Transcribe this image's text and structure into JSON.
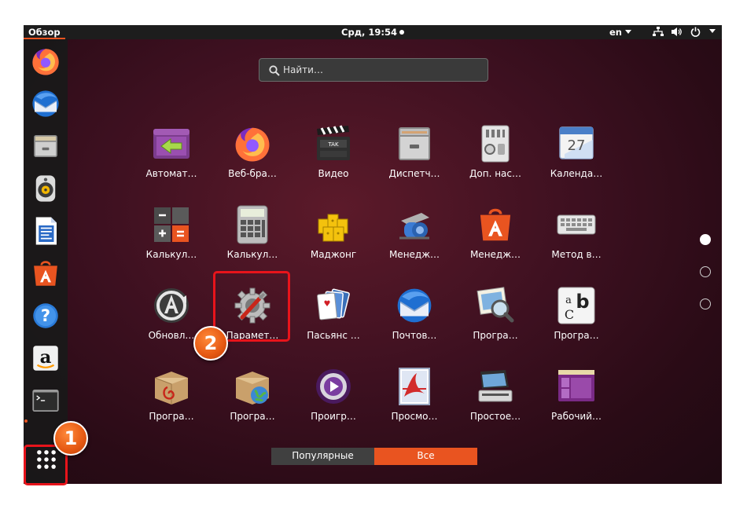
{
  "topbar": {
    "overview_label": "Обзор",
    "clock": "Срд, 19:54",
    "language": "en"
  },
  "dock": {
    "items": [
      {
        "name": "Firefox",
        "icon": "firefox-icon"
      },
      {
        "name": "Thunderbird",
        "icon": "thunderbird-icon"
      },
      {
        "name": "Files",
        "icon": "files-icon"
      },
      {
        "name": "Rhythmbox",
        "icon": "rhythmbox-icon"
      },
      {
        "name": "LibreOffice Writer",
        "icon": "writer-icon"
      },
      {
        "name": "Ubuntu Software",
        "icon": "software-icon"
      },
      {
        "name": "Help",
        "icon": "help-icon"
      },
      {
        "name": "Amazon",
        "icon": "amazon-icon"
      },
      {
        "name": "Terminal",
        "icon": "terminal-icon"
      }
    ],
    "show_apps_icon": "grid-icon"
  },
  "search": {
    "placeholder": "Найти…"
  },
  "apps": [
    {
      "label": "Автомат…",
      "icon": "automation-icon"
    },
    {
      "label": "Веб-бра…",
      "icon": "firefox-icon"
    },
    {
      "label": "Видео",
      "icon": "video-icon"
    },
    {
      "label": "Диспетч…",
      "icon": "archive-manager-icon"
    },
    {
      "label": "Доп. нас…",
      "icon": "tweaks-icon"
    },
    {
      "label": "Календа…",
      "icon": "calendar-icon"
    },
    {
      "label": "Калькул…",
      "icon": "calculator-orange-icon"
    },
    {
      "label": "Калькул…",
      "icon": "calculator-gray-icon"
    },
    {
      "label": "Маджонг",
      "icon": "mahjongg-icon"
    },
    {
      "label": "Менедж…",
      "icon": "printer-manager-icon"
    },
    {
      "label": "Менедж…",
      "icon": "software-icon"
    },
    {
      "label": "Метод в…",
      "icon": "keyboard-icon"
    },
    {
      "label": "Обновл…",
      "icon": "updater-icon"
    },
    {
      "label": "Парамет…",
      "icon": "settings-icon"
    },
    {
      "label": "Пасьянс …",
      "icon": "solitaire-icon"
    },
    {
      "label": "Почтов…",
      "icon": "thunderbird-icon"
    },
    {
      "label": "Програ…",
      "icon": "image-viewer-icon"
    },
    {
      "label": "Програ…",
      "icon": "font-viewer-icon"
    },
    {
      "label": "Програ…",
      "icon": "package-installer-icon"
    },
    {
      "label": "Програ…",
      "icon": "software-properties-icon"
    },
    {
      "label": "Проигр…",
      "icon": "media-player-icon"
    },
    {
      "label": "Просмо…",
      "icon": "document-viewer-icon"
    },
    {
      "label": "Простое…",
      "icon": "scanner-icon"
    },
    {
      "label": "Рабочий…",
      "icon": "workspace-icon"
    }
  ],
  "calendar_day": "27",
  "font_viewer_glyphs": {
    "a": "a",
    "b": "b",
    "c": "C"
  },
  "filter": {
    "popular": "Популярные",
    "all": "Все",
    "active": "all"
  },
  "pages": {
    "count": 3,
    "current": 1
  },
  "annotations": [
    {
      "number": "1",
      "target": "show-applications-button"
    },
    {
      "number": "2",
      "target": "settings-app"
    }
  ],
  "colors": {
    "accent": "#e95420",
    "highlight": "#e8141b",
    "topbar": "#1d1d1d"
  }
}
